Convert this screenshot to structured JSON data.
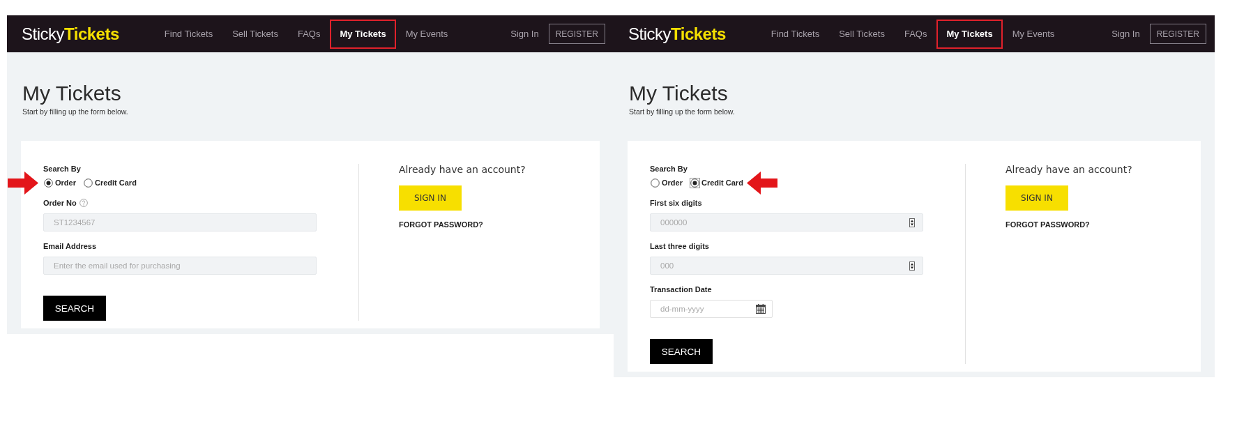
{
  "panels": [
    {
      "nav": {
        "logo": "Sticky**Tickets**",
        "links": [
          {
            "label": "Find Tickets",
            "selected": false,
            "highlighted": false
          },
          {
            "label": "Sell Tickets",
            "selected": false,
            "highlighted": false
          },
          {
            "label": "FAQs",
            "selected": false,
            "highlighted": false
          },
          {
            "label": "My Tickets",
            "selected": true,
            "highlighted": true
          },
          {
            "label": "My Events",
            "selected": false,
            "highlighted": false
          }
        ],
        "sign_in": "Sign In",
        "register": "REGISTER"
      },
      "page": {
        "title": "My Tickets",
        "subtitle": "Start by filling up the form below."
      },
      "search_form": {
        "label": "Search By",
        "options": [
          {
            "label": "Order",
            "selected": true,
            "focused": false,
            "pointed_at": true
          },
          {
            "label": "Credit Card",
            "selected": false,
            "focused": false,
            "pointed_at": false
          }
        ],
        "fields": [
          {
            "kind": "text",
            "label": "Order No",
            "help": true,
            "placeholder": "ST1234567"
          },
          {
            "kind": "text",
            "label": "Email Address",
            "help": false,
            "placeholder": "Enter the email used for purchasing"
          }
        ],
        "submit": "SEARCH"
      },
      "account": {
        "heading": "Already have an account?",
        "sign_in_button": "SIGN IN",
        "forgot_password": "FORGOT PASSWORD?"
      }
    },
    {
      "nav": {
        "logo": "Sticky**Tickets**",
        "links": [
          {
            "label": "Find Tickets",
            "selected": false,
            "highlighted": false
          },
          {
            "label": "Sell Tickets",
            "selected": false,
            "highlighted": false
          },
          {
            "label": "FAQs",
            "selected": false,
            "highlighted": false
          },
          {
            "label": "My Tickets",
            "selected": true,
            "highlighted": true
          },
          {
            "label": "My Events",
            "selected": false,
            "highlighted": false
          }
        ],
        "sign_in": "Sign In",
        "register": "REGISTER"
      },
      "page": {
        "title": "My Tickets",
        "subtitle": "Start by filling up the form below."
      },
      "search_form": {
        "label": "Search By",
        "options": [
          {
            "label": "Order",
            "selected": false,
            "focused": false,
            "pointed_at": false
          },
          {
            "label": "Credit Card",
            "selected": true,
            "focused": true,
            "pointed_at": true
          }
        ],
        "fields": [
          {
            "kind": "number",
            "label": "First six digits",
            "help": false,
            "placeholder": "000000"
          },
          {
            "kind": "number",
            "label": "Last three digits",
            "help": false,
            "placeholder": "000"
          },
          {
            "kind": "date",
            "label": "Transaction Date",
            "help": false,
            "placeholder": "dd-mm-yyyy"
          }
        ],
        "submit": "SEARCH"
      },
      "account": {
        "heading": "Already have an account?",
        "sign_in_button": "SIGN IN",
        "forgot_password": "FORGOT PASSWORD?"
      }
    }
  ]
}
